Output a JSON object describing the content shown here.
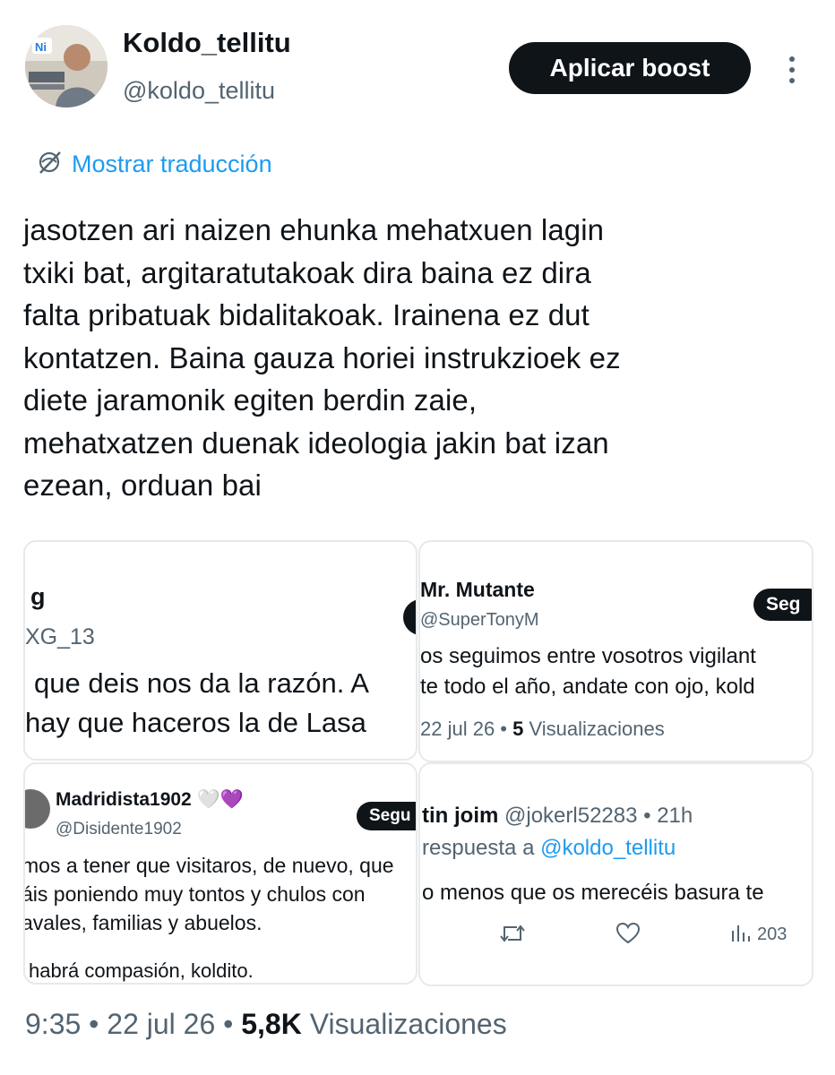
{
  "author": {
    "display_name": "Koldo_tellitu",
    "handle": "@koldo_tellitu",
    "avatar_icon": "avatar-photo"
  },
  "header": {
    "boost_label": "Aplicar boost",
    "more_icon": "more-vertical-icon"
  },
  "translation": {
    "label": "Mostrar traducción",
    "icon": "globe-translate-icon"
  },
  "tweet": {
    "lines": [
      "jasotzen ari naizen ehunka mehatxuen lagin",
      "txiki bat, argitaratutakoak dira baina ez dira",
      "falta pribatuak bidalitakoak. Irainena ez dut",
      "kontatzen. Baina gauza horiei instrukzioek ez",
      "diete jaramonik egiten berdin zaie,",
      "mehatxatzen duenak ideologia jakin bat izan",
      "ezean, orduan bai"
    ]
  },
  "collage": {
    "panel1": {
      "name": "g",
      "handle": "XG_13",
      "lines": [
        "que deis nos da la razón. A",
        "hay que haceros la de Lasa"
      ]
    },
    "panel2": {
      "name": "Mr. Mutante",
      "handle": "@SuperTonyM",
      "follow": "Seg",
      "lines": [
        "os seguimos entre vosotros vigilant",
        "te todo el año, andate con ojo, kold"
      ],
      "meta_date": "22 jul 26 • ",
      "meta_views": "5",
      "meta_views_label": " Visualizaciones"
    },
    "panel3": {
      "name": "Madridista1902",
      "emojis": "🤍💜",
      "handle": "@Disidente1902",
      "follow": "Segu",
      "lines": [
        "mos a tener que visitaros, de nuevo, que",
        "áis poniendo muy tontos y chulos con",
        "avales, familias y abuelos."
      ],
      "last_line": "habrá compasión, koldito."
    },
    "panel4": {
      "name": "tin joim",
      "handle_time": "@jokerl52283 • 21h",
      "reply_prefix": "respuesta a ",
      "reply_handle": "@koldo_tellitu",
      "line": "o menos que os merecéis basura te",
      "views_count": "203",
      "retweet_icon": "retweet-icon",
      "like_icon": "heart-icon",
      "views_icon": "bar-chart-icon"
    }
  },
  "footer": {
    "time": "9:35",
    "date": "22 jul 26",
    "views": "5,8K",
    "views_label": "Visualizaciones",
    "separator": "•"
  },
  "colors": {
    "link": "#1d9bf0",
    "muted": "#536471",
    "text": "#0f1419",
    "border": "#e7e9ea"
  }
}
